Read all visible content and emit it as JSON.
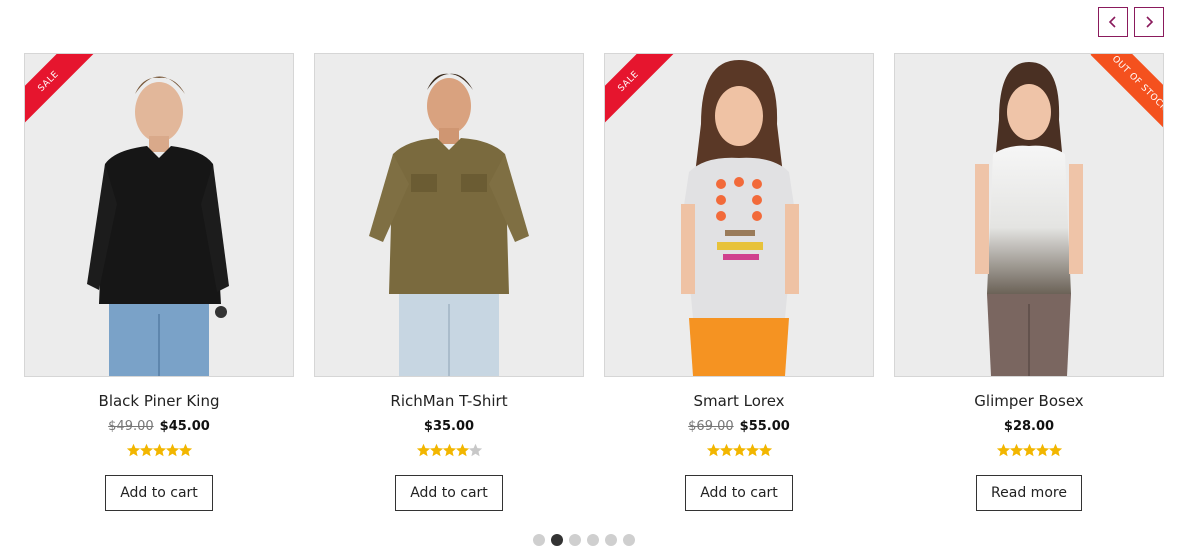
{
  "carousel": {
    "prev_icon": "chevron-left-icon",
    "next_icon": "chevron-right-icon",
    "accent_color": "#8a1a5c",
    "dots": [
      false,
      true,
      false,
      false,
      false,
      false
    ]
  },
  "products": [
    {
      "name": "Black Piner King",
      "badge": "SALE",
      "badge_color": "#e6152e",
      "old_price": "$49.00",
      "price": "$45.00",
      "rating": 5,
      "action": "Add to cart"
    },
    {
      "name": "RichMan T-Shirt",
      "badge": "",
      "old_price": "",
      "price": "$35.00",
      "rating": 4,
      "action": "Add to cart"
    },
    {
      "name": "Smart Lorex",
      "badge": "SALE",
      "badge_color": "#e6152e",
      "old_price": "$69.00",
      "price": "$55.00",
      "rating": 5,
      "action": "Add to cart"
    },
    {
      "name": "Glimper Bosex",
      "badge": "OUT OF STOCK",
      "badge_color": "#f4511e",
      "old_price": "",
      "price": "$28.00",
      "rating": 5,
      "action": "Read more"
    }
  ],
  "star_colors": {
    "filled": "#f2b600",
    "empty": "#c8c8c8"
  }
}
